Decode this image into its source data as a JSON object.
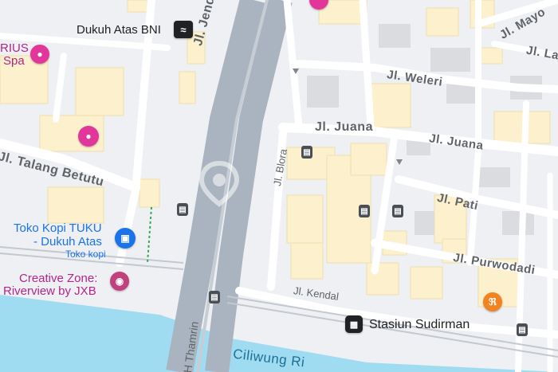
{
  "map": {
    "streets": {
      "jenderal": "Jl. Jenderal S",
      "juana_main": "Jl. Juana",
      "juana_east": "Jl. Juana",
      "weleri": "Jl. Weleri",
      "talang": "Jl. Talang Betutu",
      "blora": "Jl. Blora",
      "pati": "Jl. Pati",
      "purwodadi": "Jl. Purwodadi",
      "kendal": "Jl. Kendal",
      "thamrin": "H Thamrin",
      "mayo": "Jl. Mayo",
      "la": "Jl. La"
    },
    "pois": {
      "dukuh_atas_bni": "Dukuh Atas BNI",
      "rius_line1": "RIUS",
      "rius_line2": "Spa",
      "toko_kopi_line1": "Toko Kopi TUKU",
      "toko_kopi_line2": "- Dukuh Atas",
      "toko_kopi_sub": "Toko kopi",
      "creative_line1": "Creative Zone:",
      "creative_line2": "Riverview by JXB",
      "stasiun": "Stasiun Sudirman"
    },
    "water": {
      "river": "Ciliwung Ri"
    },
    "icons": {
      "hotel": "hotel-icon",
      "shopping": "shopping-bag-icon",
      "camera": "camera-icon",
      "restaurant": "restaurant-icon",
      "bus": "bus-icon",
      "train": "train-icon",
      "mrt": "mrt-icon"
    },
    "colors": {
      "road_main": "#aab4c0",
      "road_minor": "#ffffff",
      "building": "#fdf0cd",
      "water": "#9fdcf2",
      "poi_pink": "#e2369a",
      "poi_blue": "#1a73e8",
      "poi_orange": "#f28322"
    }
  }
}
